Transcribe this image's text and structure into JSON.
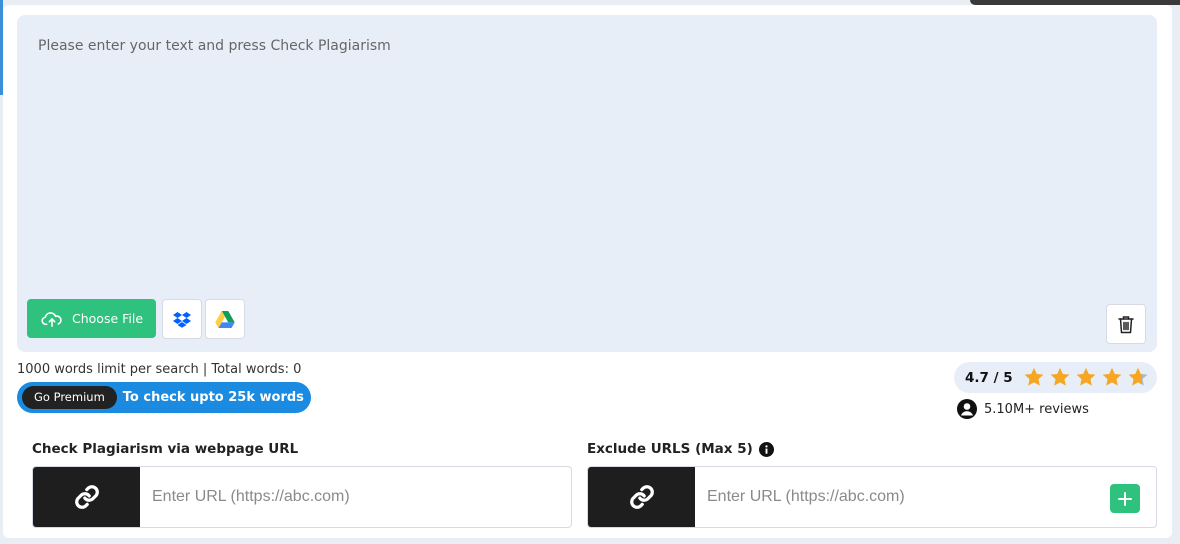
{
  "editor": {
    "placeholder": "Please enter your text and press Check Plagiarism",
    "choose_file_label": "Choose File",
    "icons": [
      "upload-cloud-icon",
      "dropbox-icon",
      "google-drive-icon",
      "trash-icon"
    ]
  },
  "limits": {
    "text": "1000 words limit per search | Total words: 0"
  },
  "premium": {
    "tag": "Go Premium",
    "text": "To check upto 25k words"
  },
  "rating": {
    "value_text": "4.7 / 5",
    "value": 4.7,
    "max": 5,
    "reviews_text": "5.10M+ reviews"
  },
  "url_check": {
    "label": "Check Plagiarism via webpage URL",
    "placeholder": "Enter URL (https://abc.com)"
  },
  "exclude_urls": {
    "label": "Exclude URLS (Max 5)",
    "placeholder": "Enter URL (https://abc.com)"
  },
  "colors": {
    "green": "#2ec27e",
    "blue": "#1a8be0",
    "star": "#f5a623",
    "dark": "#1e1e1e"
  }
}
